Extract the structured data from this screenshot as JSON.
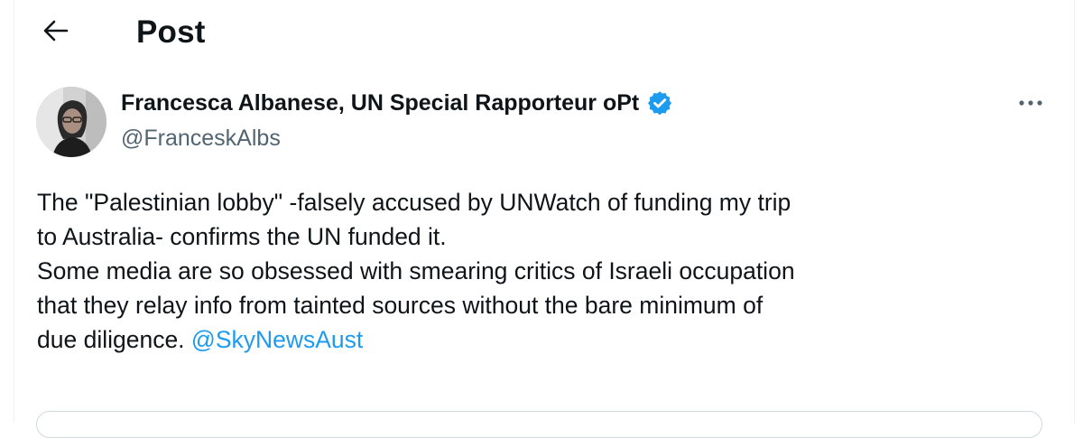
{
  "header": {
    "back_icon": "arrow-left-icon",
    "title": "Post"
  },
  "post": {
    "author": {
      "display_name": "Francesca Albanese, UN Special Rapporteur oPt",
      "handle": "@FranceskAlbs",
      "verified_icon": "verified-badge-icon",
      "avatar": "profile-photo"
    },
    "more_icon": "more-horizontal-icon",
    "text_lines": [
      "The \"Palestinian lobby\" -falsely accused by UNWatch of funding my trip",
      "to Australia- confirms the UN funded it.",
      "Some media are so obsessed with smearing critics of Israeli occupation",
      "that they relay info from tainted sources without the bare minimum of",
      "due diligence."
    ],
    "mention": "@SkyNewsAust"
  },
  "colors": {
    "text_primary": "#0f1419",
    "text_secondary": "#536471",
    "accent": "#1d9bf0",
    "border": "#cfd9de"
  }
}
